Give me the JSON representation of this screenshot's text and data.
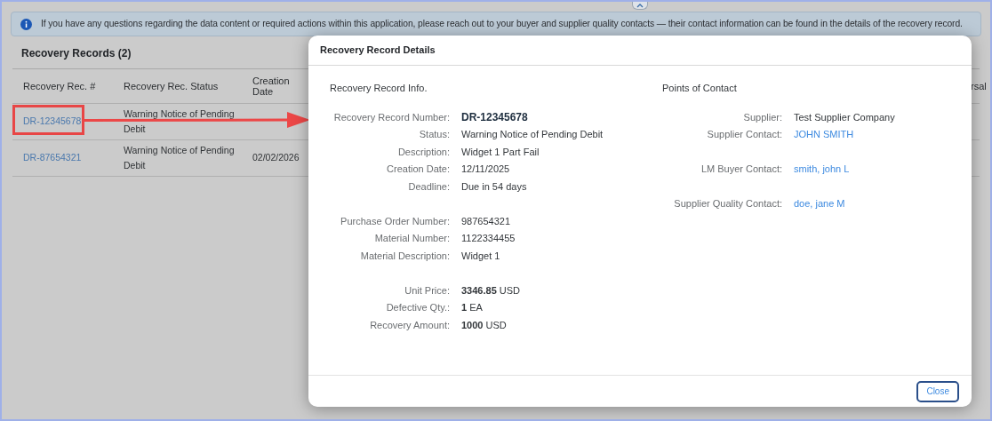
{
  "banner": {
    "text": "If you have any questions regarding the data content or required actions within this application, please reach out to your buyer and supplier quality contacts — their contact information can be found in the details of the recovery record."
  },
  "table": {
    "title": "Recovery Records (2)",
    "columns": [
      "Recovery Rec. #",
      "Recovery Rec. Status",
      "Creation Date",
      "rsal"
    ],
    "rows": [
      {
        "record": "DR-12345678",
        "status": "Warning Notice of Pending Debit",
        "highlighted": true
      },
      {
        "record": "DR-87654321",
        "status": "Warning Notice of Pending Debit",
        "date": "02/02/2026",
        "highlighted": false
      }
    ]
  },
  "dialog": {
    "title": "Recovery Record Details",
    "left": {
      "title": "Recovery Record Info.",
      "groups": [
        [
          {
            "label": "Recovery Record Number:",
            "value": "DR-12345678",
            "kind": "strong"
          },
          {
            "label": "Status:",
            "value": "Warning Notice of Pending Debit",
            "kind": "text"
          },
          {
            "label": "Description:",
            "value": "Widget 1 Part Fail",
            "kind": "text"
          },
          {
            "label": "Creation Date:",
            "value": "12/11/2025",
            "kind": "text"
          },
          {
            "label": "Deadline:",
            "value": "Due in 54 days",
            "kind": "text"
          }
        ],
        [
          {
            "label": "Purchase Order Number:",
            "value": "987654321",
            "kind": "text"
          },
          {
            "label": "Material Number:",
            "value": "1122334455",
            "kind": "text"
          },
          {
            "label": "Material Description:",
            "value": "Widget 1",
            "kind": "text"
          }
        ],
        [
          {
            "label": "Unit Price:",
            "value": "**3346.85** USD",
            "kind": "amount"
          },
          {
            "label": "Defective Qty.:",
            "value": "**1** EA",
            "kind": "amount"
          },
          {
            "label": "Recovery Amount:",
            "value": "**1000** USD",
            "kind": "amount"
          }
        ]
      ]
    },
    "right": {
      "title": "Points of Contact",
      "groups": [
        [
          {
            "label": "Supplier:",
            "value": "Test Supplier Company",
            "kind": "text"
          },
          {
            "label": "Supplier Contact:",
            "value": "JOHN SMITH",
            "kind": "link"
          }
        ],
        [
          {
            "label": "LM Buyer Contact:",
            "value": "smith, john L",
            "kind": "link"
          }
        ],
        [
          {
            "label": "Supplier Quality Contact:",
            "value": "doe, jane M",
            "kind": "link"
          }
        ]
      ]
    },
    "buttons": [
      "Close"
    ]
  }
}
